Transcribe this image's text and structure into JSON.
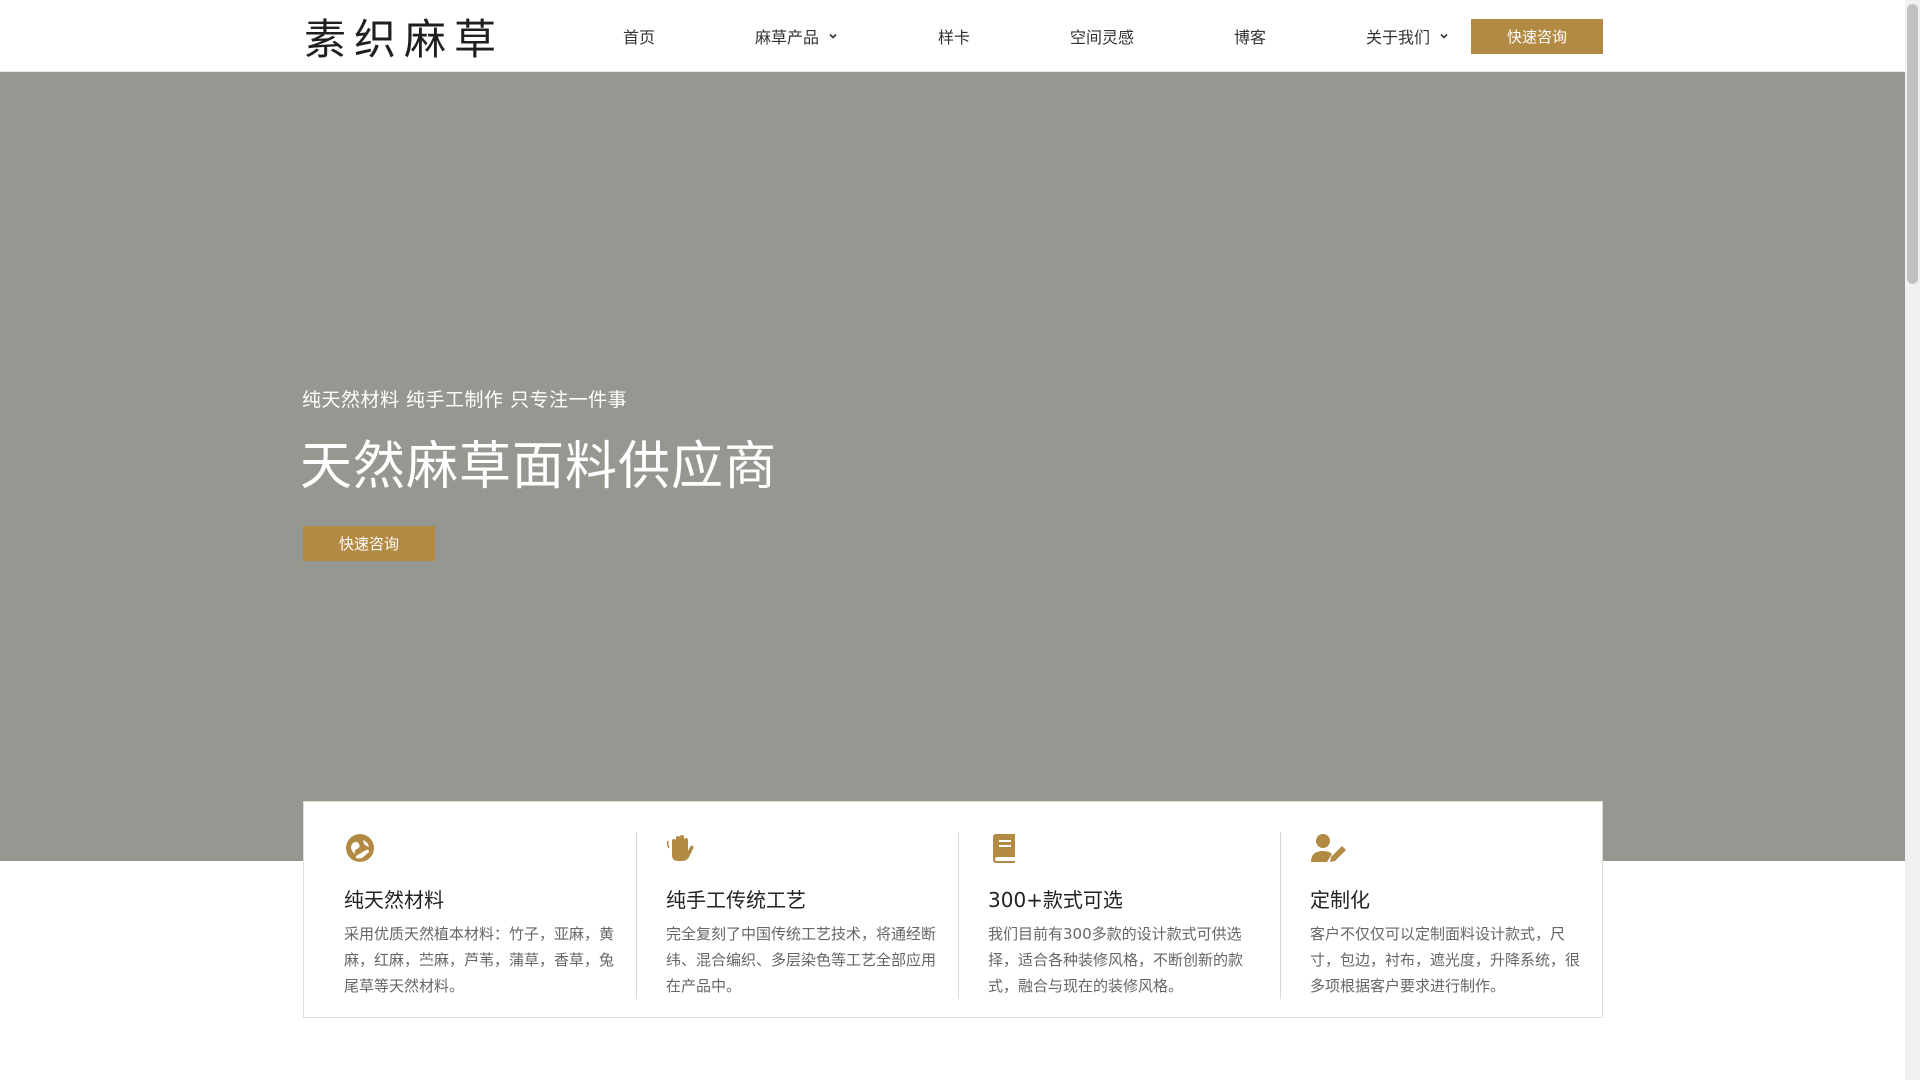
{
  "header": {
    "logo_text": "素织麻草",
    "nav": [
      {
        "label": "首页",
        "has_dropdown": false
      },
      {
        "label": "麻草产品",
        "has_dropdown": true
      },
      {
        "label": "样卡",
        "has_dropdown": false
      },
      {
        "label": "空间灵感",
        "has_dropdown": false
      },
      {
        "label": "博客",
        "has_dropdown": false
      },
      {
        "label": "关于我们",
        "has_dropdown": true
      }
    ],
    "cta_label": "快速咨询"
  },
  "hero": {
    "subtitle": "纯天然材料 纯手工制作 只专注一件事",
    "title": "天然麻草面料供应商",
    "cta_label": "快速咨询"
  },
  "features": [
    {
      "icon": "globe-hand-icon",
      "title": "纯天然材料",
      "desc": "采用优质天然植本材料：竹子，亚麻，黄麻，红麻，苎麻，芦苇，蒲草，香草，兔尾草等天然材料。"
    },
    {
      "icon": "waving-hand-icon",
      "title": "纯手工传统工艺",
      "desc": "完全复刻了中国传统工艺技术，将通经断纬、混合编织、多层染色等工艺全部应用在产品中。"
    },
    {
      "icon": "book-icon",
      "title": "300+款式可选",
      "desc": "我们目前有300多款的设计款式可供选择，适合各种装修风格，不断创新的款式，融合与现在的装修风格。"
    },
    {
      "icon": "user-edit-icon",
      "title": "定制化",
      "desc": "客户不仅仅可以定制面料设计款式，尺寸，包边，衬布，遮光度，升降系统，很多项根据客户要求进行制作。"
    }
  ],
  "colors": {
    "accent": "#b38a44",
    "hero_bg": "#959791"
  }
}
